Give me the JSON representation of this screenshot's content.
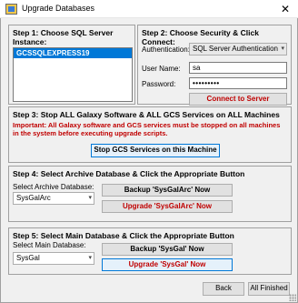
{
  "window": {
    "title": "Upgrade Databases",
    "close_glyph": "✕"
  },
  "step1": {
    "title": "Step 1: Choose SQL Server Instance:",
    "instances": [
      "GCSSQLEXPRESS19"
    ]
  },
  "step2": {
    "title": "Step 2: Choose Security & Click Connect:",
    "auth_label": "Authentication:",
    "auth_value": "SQL Server Authentication",
    "user_label": "User Name:",
    "user_value": "sa",
    "password_label": "Password:",
    "password_value": "•••••••••",
    "connect_label": "Connect to Server"
  },
  "step3": {
    "title": "Step 3: Stop ALL Galaxy Software & ALL GCS Services on ALL Machines",
    "warning": "Important: All Galaxy software and GCS services must be stopped on all machines in the system before executing upgrade scripts.",
    "stop_label": "Stop GCS Services on this Machine"
  },
  "step4": {
    "title": "Step 4: Select Archive Database & Click the Appropriate Button",
    "select_label": "Select Archive Database:",
    "select_value": "SysGalArc",
    "backup_label": "Backup 'SysGalArc' Now",
    "upgrade_label": "Upgrade 'SysGalArc' Now"
  },
  "step5": {
    "title": "Step 5: Select Main Database & Click the Appropriate Button",
    "select_label": "Select Main Database:",
    "select_value": "SysGal",
    "backup_label": "Backup 'SysGal' Now",
    "upgrade_label": "Upgrade 'SysGal' Now"
  },
  "footer": {
    "back_label": "Back",
    "finish_label": "All Finished"
  }
}
